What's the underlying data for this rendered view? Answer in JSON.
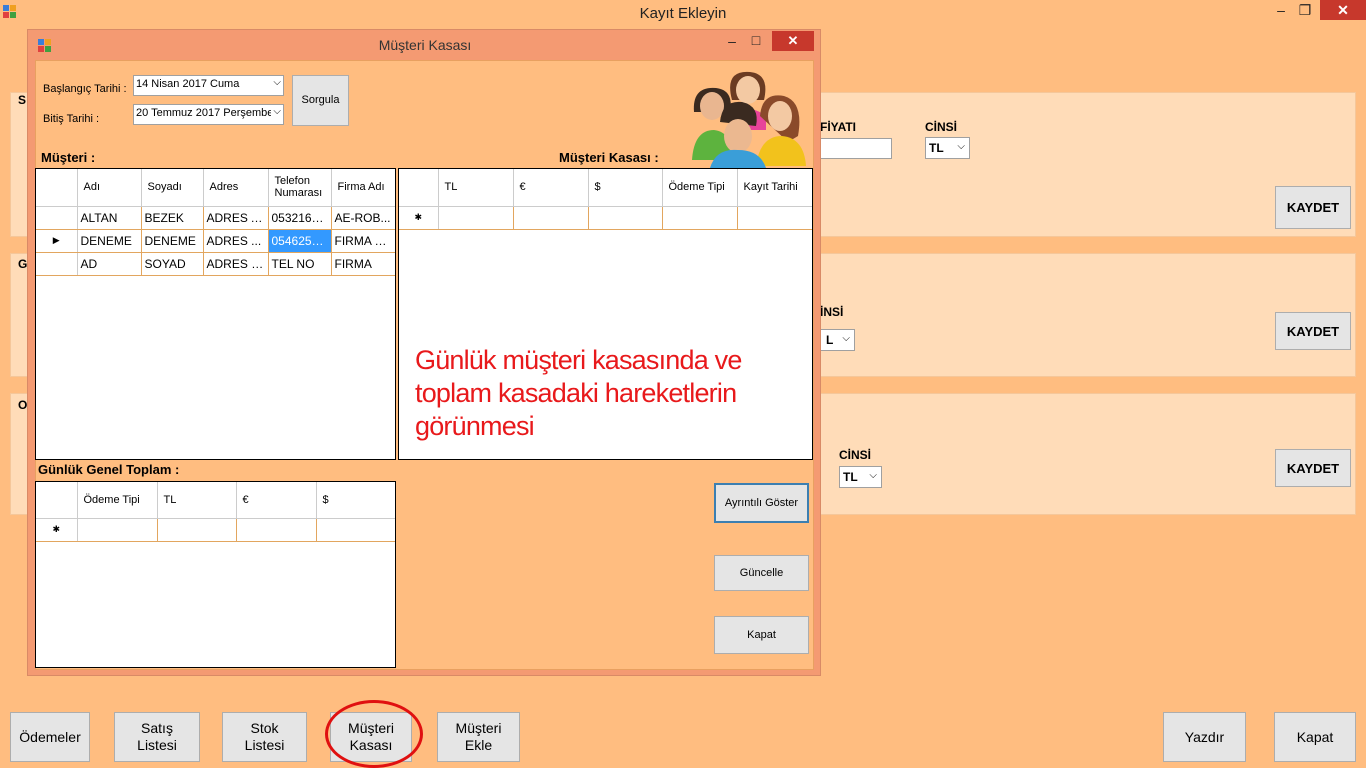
{
  "window": {
    "title": "Kayıt Ekleyin"
  },
  "background": {
    "panel1_letter": "S",
    "panel2_letter": "G",
    "panel3_letter": "O",
    "fiyati_label": "FİYATI",
    "cinsi_label": "CİNSİ",
    "cinsi_value": "TL",
    "cinsi2_label_partial": "İNSİ",
    "cinsi2_value_partial": "L",
    "cinsi3_label": "CİNSİ",
    "cinsi3_value": "TL",
    "kaydet": "KAYDET"
  },
  "dialog": {
    "title": "Müşteri Kasası",
    "start_label": "Başlangıç Tarihi :",
    "start_value": "14  Nisan   2017   Cuma",
    "end_label": "Bitiş Tarihi :",
    "end_value": "20 Temmuz 2017 Perşembe",
    "query_button": "Sorgula",
    "customers_label": "Müşteri :",
    "cash_label": "Müşteri Kasası :",
    "daily_total_label": "Günlük Genel Toplam :",
    "customers_grid": {
      "headers": [
        "Adı",
        "Soyadı",
        "Adres",
        "Telefon Numarası",
        "Firma Adı"
      ],
      "rows": [
        [
          "ALTAN",
          "BEZEK",
          "ADRES A...",
          "0532164...",
          "AE-ROB..."
        ],
        [
          "DENEME",
          "DENEME",
          "ADRES ...",
          "0546254...",
          "FIRMA D..."
        ],
        [
          "AD",
          "SOYAD",
          "ADRES B...",
          "TEL NO",
          "FIRMA"
        ]
      ]
    },
    "cash_grid": {
      "headers": [
        "TL",
        "€",
        "$",
        "Ödeme Tipi",
        "Kayıt Tarihi"
      ]
    },
    "total_grid": {
      "headers": [
        "Ödeme Tipi",
        "TL",
        "€",
        "$"
      ]
    },
    "detail_button": "Ayrıntılı Göster",
    "update_button": "Güncelle",
    "close_button": "Kapat"
  },
  "annotation": "Günlük müşteri kasasında ve toplam kasadaki hareketlerin görünmesi",
  "bottom_bar": {
    "odemeler": "Ödemeler",
    "satis_listesi": "Satış Listesi",
    "stok_listesi": "Stok Listesi",
    "musteri_kasasi": "Müşteri Kasası",
    "musteri_ekle": "Müşteri Ekle",
    "yazdir": "Yazdır",
    "kapat": "Kapat"
  },
  "colors": {
    "background": "#ffbd80",
    "panel": "#ffdcb8",
    "dialog_frame": "#f49a72",
    "annotation": "#e8191b",
    "close": "#c7382c"
  }
}
